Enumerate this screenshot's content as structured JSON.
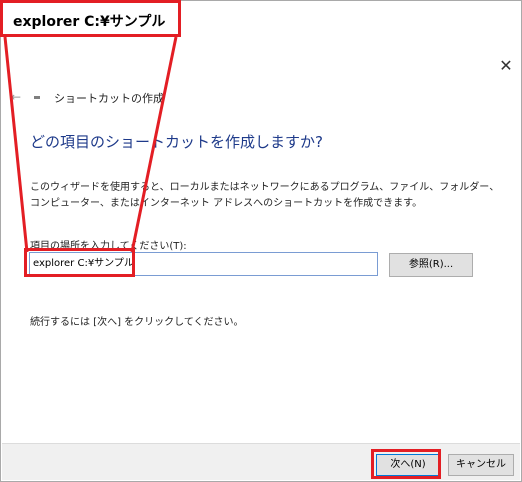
{
  "callout": {
    "text": "explorer C:¥サンプル"
  },
  "window": {
    "close_glyph": "✕",
    "back_glyph": "←",
    "title": "ショートカットの作成"
  },
  "heading": "どの項目のショートカットを作成しますか?",
  "description": "このウィザードを使用すると、ローカルまたはネットワークにあるプログラム、ファイル、フォルダー、コンピューター、またはインターネット アドレスへのショートカットを作成できます。",
  "location": {
    "label": "項目の場所を入力してください(T):",
    "value": "explorer C:¥サンプル"
  },
  "browse_button": "参照(R)...",
  "continue_text": "続行するには [次へ] をクリックしてください。",
  "footer": {
    "next_button": "次へ(N)",
    "cancel_button": "キャンセル"
  },
  "colors": {
    "highlight": "#e31e24",
    "heading": "#1e3a8a",
    "input_border": "#7a9cd3"
  }
}
